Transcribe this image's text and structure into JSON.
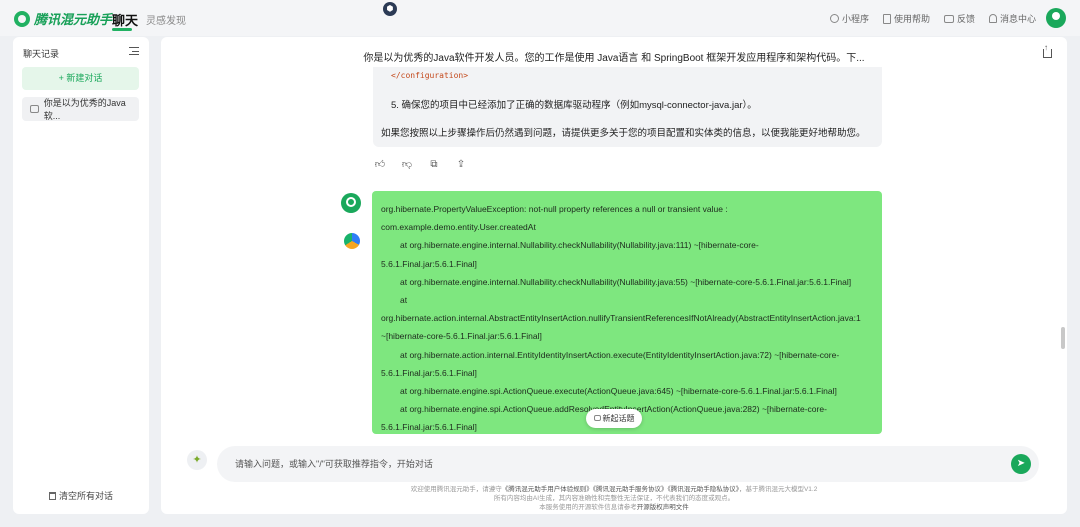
{
  "app": {
    "brand": "腾讯混元助手",
    "nav": {
      "chat": "聊天",
      "inspiration": "灵感发现"
    },
    "top_right": {
      "mini_program": "小程序",
      "help": "使用帮助",
      "feedback": "反馈",
      "messages": "消息中心"
    }
  },
  "sidebar": {
    "title": "聊天记录",
    "new_chat": "+ 新建对话",
    "items": [
      {
        "label": "你是以为优秀的Java软..."
      }
    ],
    "clear_all": "清空所有对话"
  },
  "conversation": {
    "title": "你是以为优秀的Java软件开发人员。您的工作是使用 Java语言 和 SpringBoot 框架开发应用程序和架构代码。下...",
    "ai_partial": {
      "code_tail": "</configuration>",
      "step5": "5. 确保您的项目中已经添加了正确的数据库驱动程序（例如mysql-connector-java.jar）。",
      "closing": "如果您按照以上步骤操作后仍然遇到问题，请提供更多关于您的项目配置和实体类的信息，以便我能更好地帮助您。"
    },
    "actions": [
      "like-icon",
      "dislike-icon",
      "copy-icon",
      "share-icon"
    ],
    "user_message_lines": [
      {
        "text": "org.hibernate.PropertyValueException: not-null property references a null or transient value :",
        "indent": false
      },
      {
        "text": "com.example.demo.entity.User.createdAt",
        "indent": false
      },
      {
        "text": "at org.hibernate.engine.internal.Nullability.checkNullability(Nullability.java:111) ~[hibernate-core-",
        "indent": true
      },
      {
        "text": "5.6.1.Final.jar:5.6.1.Final]",
        "indent": false
      },
      {
        "text": "at org.hibernate.engine.internal.Nullability.checkNullability(Nullability.java:55) ~[hibernate-core-5.6.1.Final.jar:5.6.1.Final]",
        "indent": true
      },
      {
        "text": "at",
        "indent": true
      },
      {
        "text": "org.hibernate.action.internal.AbstractEntityInsertAction.nullifyTransientReferencesIfNotAlready(AbstractEntityInsertAction.java:1",
        "indent": false
      },
      {
        "text": "~[hibernate-core-5.6.1.Final.jar:5.6.1.Final]",
        "indent": false
      },
      {
        "text": "at org.hibernate.action.internal.EntityIdentityInsertAction.execute(EntityIdentityInsertAction.java:72) ~[hibernate-core-",
        "indent": true
      },
      {
        "text": "5.6.1.Final.jar:5.6.1.Final]",
        "indent": false
      },
      {
        "text": "at org.hibernate.engine.spi.ActionQueue.execute(ActionQueue.java:645) ~[hibernate-core-5.6.1.Final.jar:5.6.1.Final]",
        "indent": true
      },
      {
        "text": "at org.hibernate.engine.spi.ActionQueue.addResolvedEntityInsertAction(ActionQueue.java:282) ~[hibernate-core-",
        "indent": true
      },
      {
        "text": "5.6.1.Final.jar:5.6.1.Final]",
        "indent": false
      }
    ],
    "new_topic": "新起话题"
  },
  "input": {
    "placeholder": "请输入问题，或输入\"/\"可获取推荐指令，开始对话"
  },
  "footer": {
    "line1_prefix": "欢迎使用腾讯混元助手，请遵守",
    "link1": "《腾讯混元助手用户体验规则》",
    "link2": "《腾讯混元助手服务协议》",
    "link3": "《腾讯混元助手隐私协议》",
    "line1_suffix": "，基于腾讯混元大模型V1.2",
    "line2": "所有内容均由AI生成，其内容准确性和完整性无法保证，不代表我们的态度或观点。",
    "line3_prefix": "本服务使用的开源软件信息请参考",
    "line3_link": "开源版权声明文件"
  },
  "colors": {
    "brand": "#1aa85b",
    "user_bubble": "#7ee77f"
  }
}
